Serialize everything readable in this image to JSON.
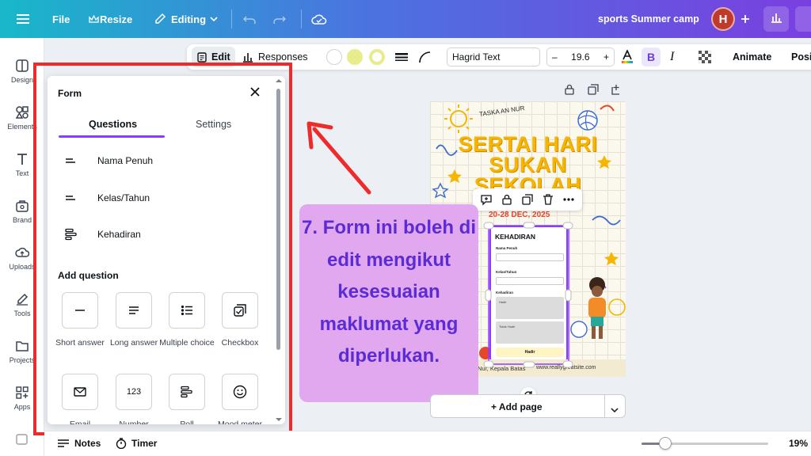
{
  "topbar": {
    "file": "File",
    "resize": "Resize",
    "editing": "Editing",
    "project_name": "sports Summer camp",
    "avatar_initial": "H"
  },
  "rail": [
    {
      "label": "Design",
      "icon": "design-icon"
    },
    {
      "label": "Elements",
      "icon": "elements-icon"
    },
    {
      "label": "Text",
      "icon": "text-icon"
    },
    {
      "label": "Brand",
      "icon": "brand-icon"
    },
    {
      "label": "Uploads",
      "icon": "uploads-icon"
    },
    {
      "label": "Tools",
      "icon": "tools-icon"
    },
    {
      "label": "Projects",
      "icon": "projects-icon"
    },
    {
      "label": "Apps",
      "icon": "apps-icon"
    }
  ],
  "toolbar": {
    "edit": "Edit",
    "responses": "Responses",
    "font": "Hagrid Text",
    "font_size": "19.6",
    "minus": "–",
    "plus": "+",
    "bold": "B",
    "italic": "I",
    "animate": "Animate",
    "position": "Positi"
  },
  "panel": {
    "title": "Form",
    "tabs": {
      "questions": "Questions",
      "settings": "Settings"
    },
    "questions": [
      "Nama Penuh",
      "Kelas/Tahun",
      "Kehadiran"
    ],
    "add_question": "Add question",
    "types": [
      "Short answer",
      "Long answer",
      "Multiple choice",
      "Checkbox",
      "Email",
      "Number",
      "Poll",
      "Mood meter"
    ],
    "number_icon": "123"
  },
  "canvas": {
    "school": "TASKA AN NUR",
    "headline": [
      "SERTAI HARI",
      "SUKAN",
      "SEKOLAH"
    ],
    "date": "20-28 DEC, 2025",
    "form_title": "KEHADIRAN",
    "form_labels": [
      "Nama Penuh",
      "Kelas/Tahun",
      "Kehadiran"
    ],
    "options": [
      "Hadir",
      "Tidak Hadir"
    ],
    "submit": "Hadir",
    "footer_left": "Nur, Kepala Batas",
    "footer_right": "www.reallygreatsite.com"
  },
  "callout": "7. Form ini boleh di edit mengikut kesesuaian maklumat yang diperlukan.",
  "add_page": "+ Add page",
  "bottom": {
    "notes": "Notes",
    "timer": "Timer",
    "zoom": "19%",
    "zoom_fraction": 0.19
  },
  "colors": {
    "accent": "#8b3dff",
    "annotation_red": "#ee2a2a",
    "callout_bg": "#e1a8ef",
    "callout_text": "#5b2bd6",
    "headline": "#f6b500"
  }
}
